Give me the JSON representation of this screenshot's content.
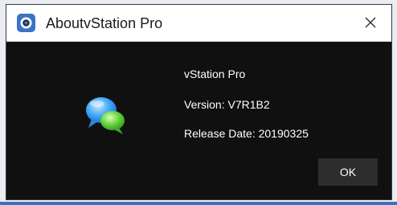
{
  "window": {
    "title": "AboutvStation Pro",
    "app_icon": "camera-lens-icon",
    "close_icon": "close-icon"
  },
  "about": {
    "product_name": "vStation Pro",
    "version": "Version: V7R1B2",
    "release_date": "Release Date: 20190325",
    "logo_icon": "chat-bubbles-icon"
  },
  "buttons": {
    "ok_label": "OK"
  },
  "colors": {
    "dialog_background": "#101010",
    "titlebar_background": "#ffffff",
    "app_icon_blue": "#3b74c6",
    "button_background": "#2d2d2d",
    "text_light": "#ffffff"
  }
}
